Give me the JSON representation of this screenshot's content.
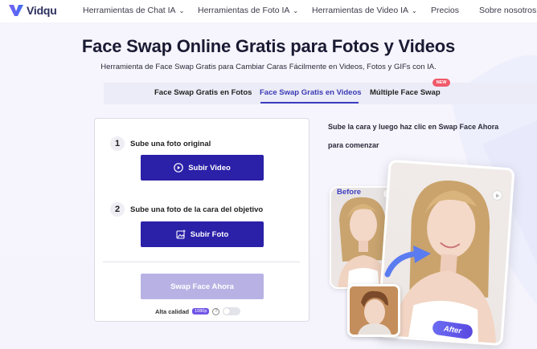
{
  "brand": {
    "name": "Vidqu"
  },
  "nav": {
    "items": [
      {
        "label": "Herramientas de Chat IA",
        "has_dropdown": true
      },
      {
        "label": "Herramientas de Foto IA",
        "has_dropdown": true
      },
      {
        "label": "Herramientas de Video IA",
        "has_dropdown": true
      },
      {
        "label": "Precios",
        "has_dropdown": false
      },
      {
        "label": "Sobre nosotros",
        "has_dropdown": false
      }
    ],
    "dropdown_glyph": "⌄"
  },
  "hero": {
    "title": "Face Swap Online Gratis para Fotos y Videos",
    "subtitle": "Herramienta de Face Swap Gratis para Cambiar Caras Fácilmente en Videos, Fotos y GIFs con IA."
  },
  "tabs": [
    {
      "label": "Face Swap Gratis en Fotos",
      "active": false
    },
    {
      "label": "Face Swap Gratis en Videos",
      "active": true
    },
    {
      "label": "Múltiple Face Swap",
      "active": false,
      "badge": "NEW"
    }
  ],
  "upload_card": {
    "step1": {
      "number": "1",
      "label": "Sube una foto original",
      "button": "Subir Video",
      "icon": "play-circle-icon"
    },
    "step2": {
      "number": "2",
      "label": "Sube una foto de la cara del objetivo",
      "button": "Subir Foto",
      "icon": "image-upload-icon"
    },
    "swap_button": "Swap Face Ahora",
    "quality": {
      "label": "Alta calidad",
      "resolution": "1080p",
      "help": "?",
      "enabled": false
    }
  },
  "instructions": {
    "line1": "Sube la cara y luego haz clic en Swap Face Ahora",
    "line2": "para comenzar"
  },
  "preview": {
    "before_label": "Before",
    "after_label": "After"
  },
  "colors": {
    "primary_button": "#2b20a8",
    "disabled_button": "#b8b2e4",
    "active_tab": "#3a3ab4",
    "new_badge": "#f05a6a",
    "resolution_badge": "#6f55e6"
  }
}
